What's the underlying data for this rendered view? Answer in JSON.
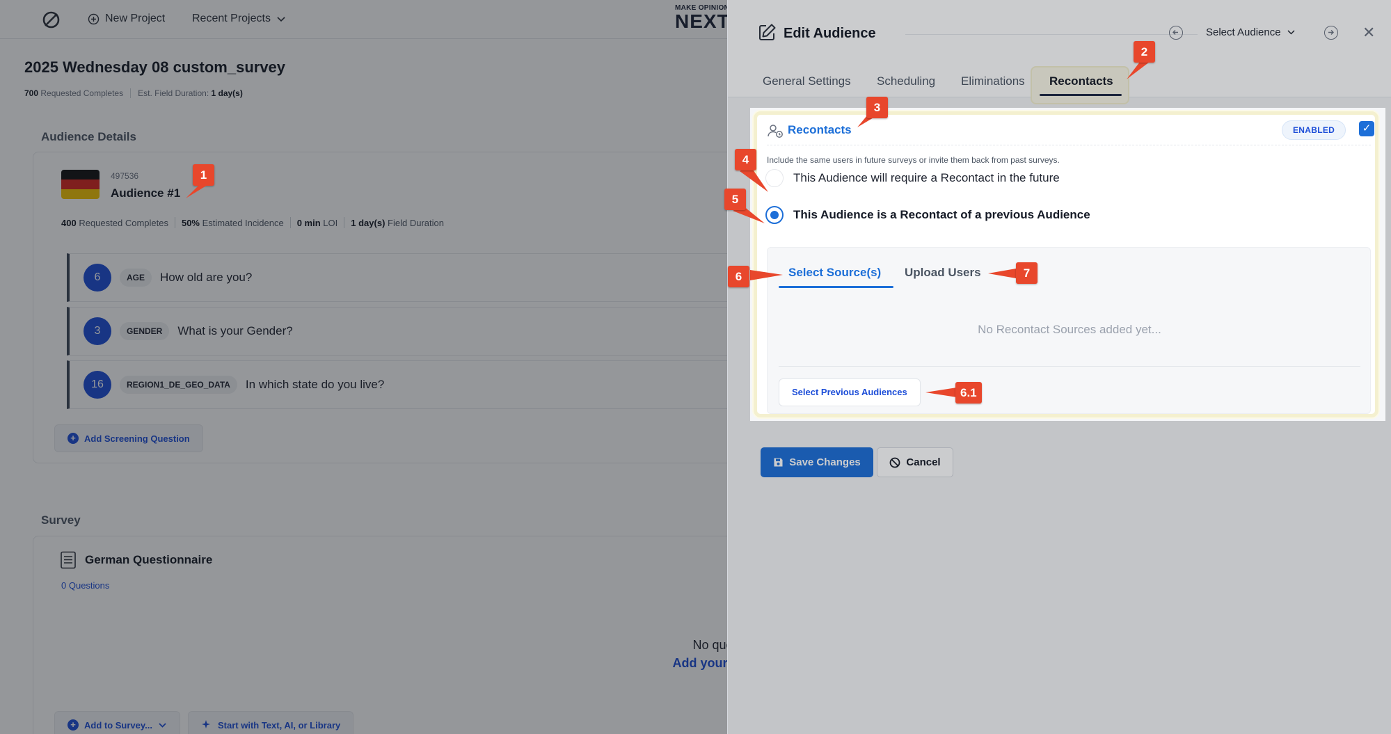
{
  "topbar": {
    "new_project": "New Project",
    "recent_projects": "Recent Projects",
    "brand_small": "MAKE OPINION",
    "brand_big": "NEXT"
  },
  "project": {
    "title": "2025 Wednesday 08 custom_survey",
    "requested_value": "700",
    "requested_label": "Requested Completes",
    "duration_label": "Est. Field Duration:",
    "duration_value": "1 day(s)"
  },
  "audience_section": {
    "heading": "Audience Details",
    "audience_id": "497536",
    "audience_name": "Audience #1",
    "stats": [
      {
        "value": "400",
        "label": "Requested Completes"
      },
      {
        "value": "50%",
        "label": "Estimated Incidence"
      },
      {
        "value": "0 min",
        "label": "LOI"
      },
      {
        "value": "1 day(s)",
        "label": "Field Duration"
      }
    ],
    "questions": [
      {
        "num": "6",
        "tag": "AGE",
        "text": "How old are you?"
      },
      {
        "num": "3",
        "tag": "GENDER",
        "text": "What is your Gender?"
      },
      {
        "num": "16",
        "tag": "REGION1_DE_GEO_DATA",
        "text": "In which state do you live?"
      }
    ],
    "add_screening": "Add Screening Question"
  },
  "survey_section": {
    "heading": "Survey",
    "questionnaire_title": "German Questionnaire",
    "question_count": "0",
    "question_label": "Questions",
    "empty_line1": "No questions ac",
    "empty_line2": "Add your first questio",
    "add_to_survey": "Add to Survey...",
    "start_with": "Start with Text, AI, or Library"
  },
  "panel": {
    "title": "Edit Audience",
    "select_audience": "Select Audience",
    "tabs": [
      "General Settings",
      "Scheduling",
      "Eliminations",
      "Recontacts"
    ],
    "active_tab": "Recontacts",
    "recontacts": {
      "title": "Recontacts",
      "badge": "ENABLED",
      "description": "Include the same users in future surveys or invite them back from past surveys.",
      "option_future": "This Audience will require a Recontact in the future",
      "option_previous": "This Audience is a Recontact of a previous Audience",
      "source_tabs": [
        "Select Source(s)",
        "Upload Users"
      ],
      "empty_sources": "No Recontact Sources added yet...",
      "select_previous": "Select Previous Audiences"
    },
    "save": "Save Changes",
    "cancel": "Cancel"
  },
  "callouts": [
    "1",
    "2",
    "3",
    "4",
    "5",
    "6",
    "7",
    "6.1"
  ],
  "colors": {
    "accent": "#1d6fd8",
    "callout": "#e8472c",
    "highlight": "#f4f0cf"
  }
}
